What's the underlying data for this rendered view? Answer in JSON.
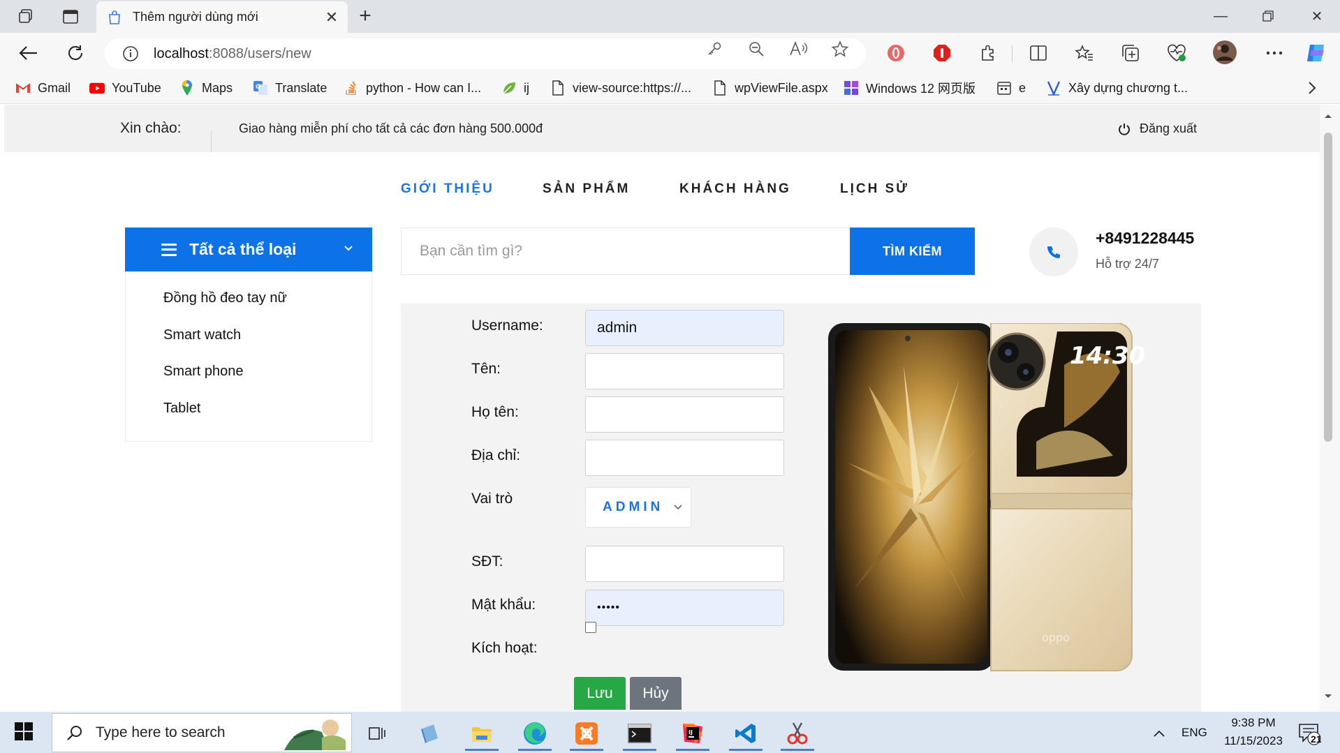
{
  "browser": {
    "tab_title": "Thêm người dùng mới",
    "url_host": "localhost",
    "url_rest": ":8088/users/new",
    "bookmarks": [
      {
        "label": "Gmail",
        "icon": "gmail-icon"
      },
      {
        "label": "YouTube",
        "icon": "youtube-icon"
      },
      {
        "label": "Maps",
        "icon": "maps-icon"
      },
      {
        "label": "Translate",
        "icon": "translate-icon"
      },
      {
        "label": "python - How can I...",
        "icon": "stackoverflow-icon"
      },
      {
        "label": "ij",
        "icon": "leaf-icon"
      },
      {
        "label": "view-source:https://...",
        "icon": "page-icon"
      },
      {
        "label": "wpViewFile.aspx",
        "icon": "page-icon"
      },
      {
        "label": "Windows 12 网页版",
        "icon": "windows-icon"
      },
      {
        "label": "e",
        "icon": "calendar-icon"
      },
      {
        "label": "Xây dựng chương t...",
        "icon": "v-icon"
      }
    ]
  },
  "site": {
    "greeting": "Xin chào:",
    "promo": "Giao hàng miễn phí cho tất cả các đơn hàng 500.000đ",
    "logout": "Đăng xuất",
    "nav": [
      "GIỚI THIỆU",
      "SẢN PHẨM",
      "KHÁCH HÀNG",
      "LỊCH SỬ"
    ],
    "categories_title": "Tất cả thể loại",
    "categories": [
      "Đồng hồ đeo tay nữ",
      "Smart watch",
      "Smart phone",
      "Tablet"
    ],
    "search_placeholder": "Bạn cần tìm gì?",
    "search_button": "TÌM KIẾM",
    "phone": "+8491228445",
    "support": "Hỗ trợ 24/7"
  },
  "form": {
    "username_label": "Username:",
    "username_value": "admin",
    "ten_label": "Tên:",
    "hoten_label": "Họ tên:",
    "diachi_label": "Địa chỉ:",
    "vaitro_label": "Vai trò",
    "vaitro_value": "ADMIN",
    "sdt_label": "SĐT:",
    "matkhau_label": "Mật khẩu:",
    "matkhau_value": "•••••",
    "kichhoat_label": "Kích hoạt:",
    "kichhoat_checked": false,
    "save": "Lưu",
    "cancel": "Hủy"
  },
  "product_image": {
    "screen_time": "14:30",
    "brand_text": "oppo"
  },
  "taskbar": {
    "search_placeholder": "Type here to search",
    "lang": "ENG",
    "time": "9:38 PM",
    "date": "11/15/2023",
    "notifications": "21"
  },
  "colors": {
    "brand_blue": "#0d72e8",
    "save_green": "#28a745",
    "cancel_gray": "#6c757d"
  }
}
